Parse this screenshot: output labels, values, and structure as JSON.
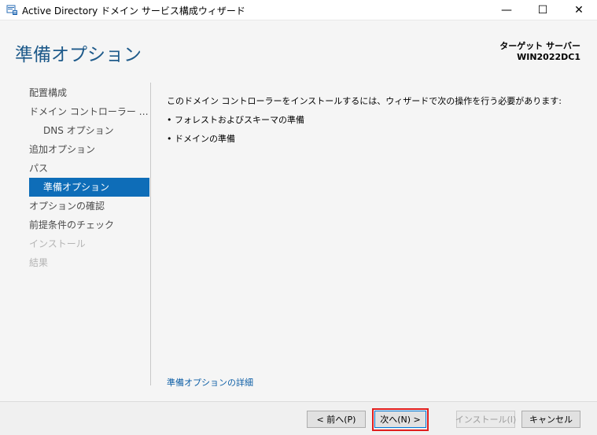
{
  "window": {
    "title": "Active Directory ドメイン サービス構成ウィザード",
    "minimize_glyph": "—",
    "maximize_glyph": "☐",
    "close_glyph": "✕"
  },
  "header": {
    "page_title": "準備オプション",
    "target_label": "ターゲット サーバー",
    "target_name": "WIN2022DC1"
  },
  "nav": {
    "items": [
      {
        "label": "配置構成",
        "state": "normal"
      },
      {
        "label": "ドメイン コントローラー オプション",
        "state": "normal"
      },
      {
        "label": "DNS オプション",
        "state": "sub"
      },
      {
        "label": "追加オプション",
        "state": "normal"
      },
      {
        "label": "パス",
        "state": "normal"
      },
      {
        "label": "準備オプション",
        "state": "active"
      },
      {
        "label": "オプションの確認",
        "state": "normal"
      },
      {
        "label": "前提条件のチェック",
        "state": "normal"
      },
      {
        "label": "インストール",
        "state": "disabled"
      },
      {
        "label": "結果",
        "state": "disabled"
      }
    ]
  },
  "main": {
    "intro": "このドメイン コントローラーをインストールするには、ウィザードで次の操作を行う必要があります:",
    "bullets": [
      "フォレストおよびスキーマの準備",
      "ドメインの準備"
    ],
    "bullet_glyph": "•",
    "detail_link": "準備オプションの詳細"
  },
  "footer": {
    "prev_label": "< 前へ(P)",
    "next_label": "次へ(N) >",
    "install_label": "インストール(I)",
    "cancel_label": "キャンセル"
  },
  "colors": {
    "title_accent": "#1e5a8a",
    "nav_active_bg": "#0e6db8",
    "highlight_outline": "#e01e1e",
    "link": "#0e5fa6"
  }
}
